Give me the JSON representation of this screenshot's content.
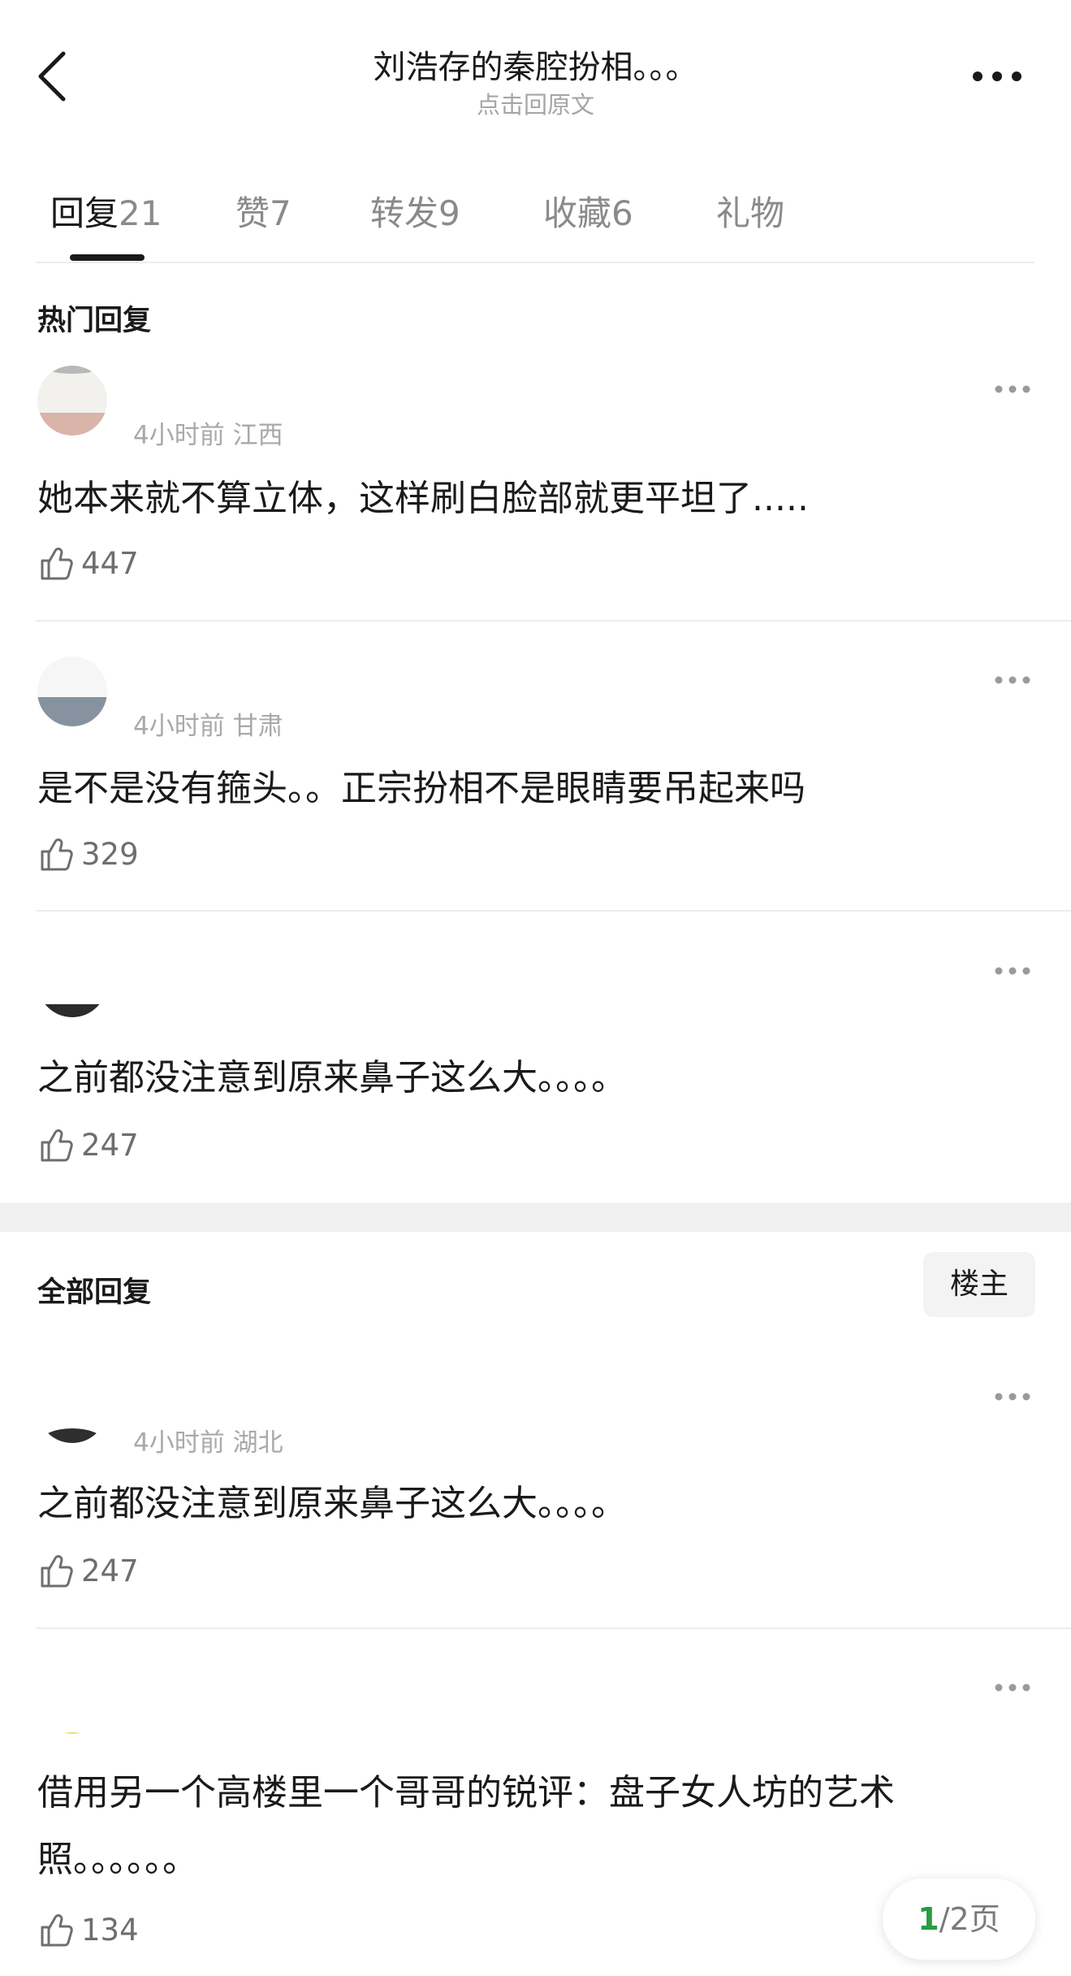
{
  "header": {
    "title": "刘浩存的秦腔扮相。。。",
    "subtitle": "点击回原文",
    "back_icon": "chevron-left-icon",
    "more_icon": "more-horizontal-icon"
  },
  "tabs": [
    {
      "label": "回复",
      "count": "21",
      "active": true
    },
    {
      "label": "赞",
      "count": "7",
      "active": false
    },
    {
      "label": "转发",
      "count": "9",
      "active": false
    },
    {
      "label": "收藏",
      "count": "6",
      "active": false
    },
    {
      "label": "礼物",
      "count": "",
      "active": false
    }
  ],
  "hot": {
    "section_title": "热门回复",
    "comments": [
      {
        "meta": "4小时前 江西",
        "text": "她本来就不算立体，这样刷白脸部就更平坦了.....",
        "likes": "447"
      },
      {
        "meta": "4小时前 甘肃",
        "text": "是不是没有箍头。。正宗扮相不是眼睛要吊起来吗",
        "likes": "329"
      },
      {
        "meta": "",
        "text": "之前都没注意到原来鼻子这么大。。。。",
        "likes": "247"
      }
    ]
  },
  "all": {
    "section_title": "全部回复",
    "owner_button": "楼主",
    "comments": [
      {
        "meta": "4小时前 湖北",
        "text": "之前都没注意到原来鼻子这么大。。。。",
        "likes": "247"
      },
      {
        "meta": "",
        "text_line1": "借用另一个高楼里一个哥哥的锐评：盘子女人坊的艺术",
        "text_line2": "照。。。。。。",
        "likes": "134"
      }
    ]
  },
  "pager": {
    "current": "1",
    "total_text": "/2页"
  },
  "colors": {
    "accent_green": "#2a9c43",
    "divider": "#ececec",
    "muted_text": "#a9a9a9"
  }
}
